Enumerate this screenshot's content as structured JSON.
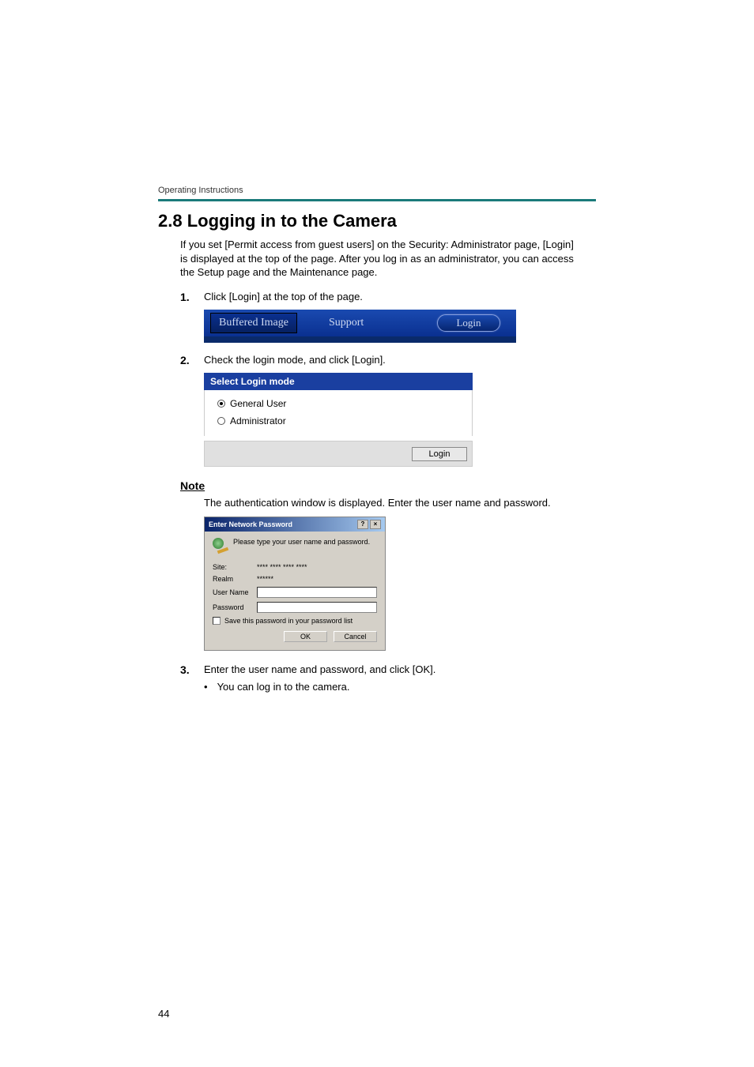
{
  "doc_header": "Operating Instructions",
  "section_title": "2.8   Logging in to the Camera",
  "intro": "If you set [Permit access from guest users] on the Security: Administrator page, [Login] is displayed at the top of the page. After you log in as an administrator, you can access the Setup page and the Maintenance page.",
  "steps": {
    "s1_num": "1.",
    "s1_text": "Click [Login] at the top of the page.",
    "s2_num": "2.",
    "s2_text": "Check the login mode, and click [Login].",
    "s3_num": "3.",
    "s3_text": "Enter the user name and password, and click [OK].",
    "s3_bullet_dot": "•",
    "s3_bullet": "You can log in to the camera."
  },
  "login_bar": {
    "tab": "Buffered Image",
    "support": "Support",
    "login": "Login"
  },
  "login_mode_panel": {
    "title": "Select Login mode",
    "opt1": "General User",
    "opt2": "Administrator",
    "login_btn": "Login"
  },
  "note_heading": "Note",
  "note_text": "The authentication window is displayed. Enter the user name and password.",
  "auth_dialog": {
    "title": "Enter Network Password",
    "help_btn": "?",
    "close_btn": "×",
    "prompt": "Please type your user name and password.",
    "site_label": "Site:",
    "site_value": "**** **** **** ****",
    "realm_label": "Realm",
    "realm_value": "******",
    "user_label": "User Name",
    "pass_label": "Password",
    "save_label": "Save this password in your password list",
    "ok": "OK",
    "cancel": "Cancel"
  },
  "page_num": "44"
}
